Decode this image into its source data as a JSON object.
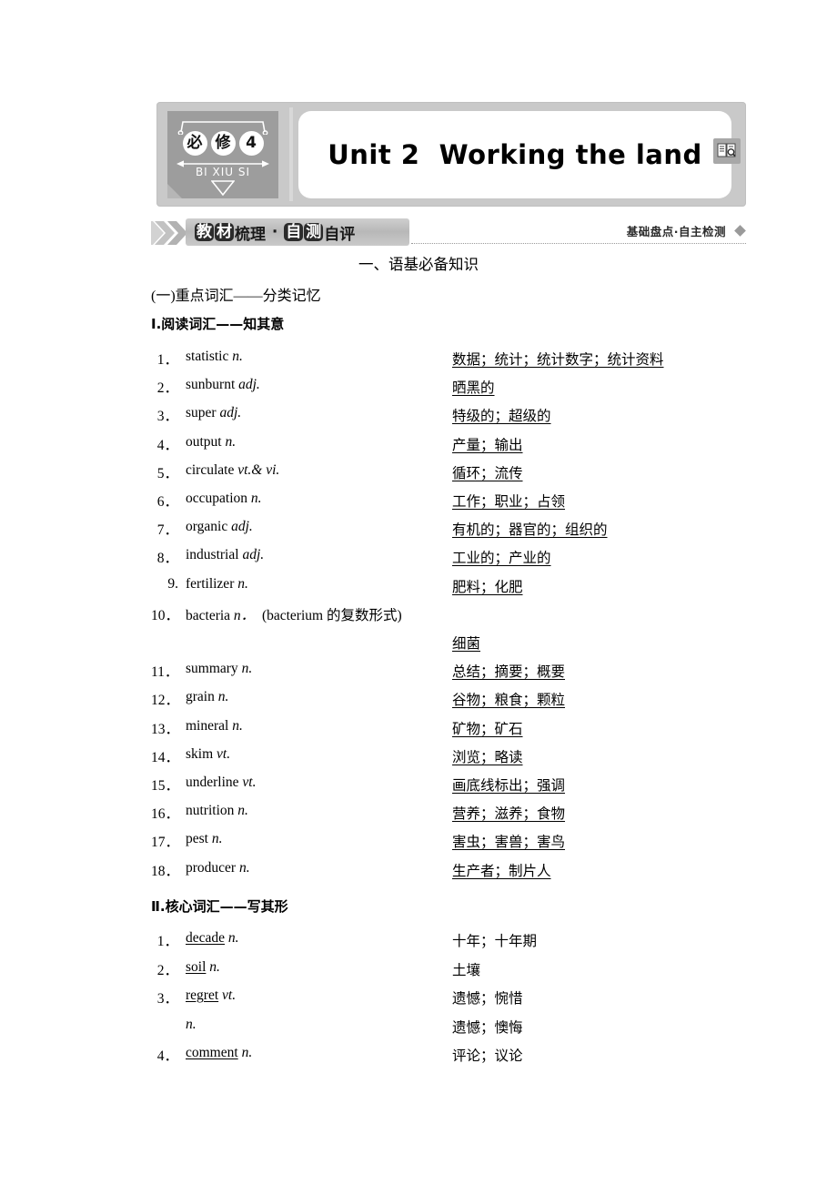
{
  "banner": {
    "badge": {
      "circles": [
        "必",
        "修",
        "4"
      ],
      "pinyin": "BI XIU SI"
    },
    "unit_title": "Unit 2  Working the land",
    "book_icon": "book-search-icon"
  },
  "section_header": {
    "title_parts": [
      {
        "text": "教",
        "boxed": true
      },
      {
        "text": "材",
        "boxed": true
      },
      {
        "text": "梳理",
        "boxed": false
      },
      {
        "text": " · ",
        "boxed": false
      },
      {
        "text": "自",
        "boxed": true
      },
      {
        "text": "测",
        "boxed": true
      },
      {
        "text": "自评",
        "boxed": false
      }
    ],
    "title_plain": "教材梳理·自测自评",
    "right_label": "基础盘点·自主检测"
  },
  "headings": {
    "part_one": "一、语基必备知识",
    "sub_one": "(一)重点词汇——分类记忆",
    "list_one_title": "Ⅰ.阅读词汇——知其意",
    "list_two_title": "Ⅱ.核心词汇——写其形"
  },
  "reading_vocab": [
    {
      "num": "1．",
      "word": "statistic ",
      "pos": "n.",
      "def": "数据；统计；统计数字；统计资料",
      "underlined": true
    },
    {
      "num": "2．",
      "word": "sunburnt ",
      "pos": "adj.",
      "def": "晒黑的",
      "underlined": true
    },
    {
      "num": "3．",
      "word": "super ",
      "pos": "adj.",
      "def": "特级的；超级的",
      "underlined": true
    },
    {
      "num": "4．",
      "word": "output ",
      "pos": "n.",
      "def": "产量；输出",
      "underlined": true
    },
    {
      "num": "5．",
      "word": "circulate ",
      "pos": "vt.& vi.",
      "def": "循环；流传",
      "underlined": true
    },
    {
      "num": "6．",
      "word": "occupation ",
      "pos": "n.",
      "def": "工作；职业；占领",
      "underlined": true
    },
    {
      "num": "7．",
      "word": "organic ",
      "pos": "adj.",
      "def": "有机的；器官的；组织的",
      "underlined": true
    },
    {
      "num": "8．",
      "word": "industrial ",
      "pos": "adj.",
      "def": "工业的；产业的",
      "underlined": true
    },
    {
      "num": "9.",
      "word": "fertilizer ",
      "pos": "n.",
      "def": "肥料；化肥",
      "underlined": true
    },
    {
      "num": "10．",
      "word": "bacteria ",
      "pos": "n．",
      "note": "(bacterium 的复数形式)",
      "def": "",
      "underlined": true
    },
    {
      "num": "",
      "word": "",
      "pos": "",
      "def": "细菌",
      "underlined": true
    },
    {
      "num": "11．",
      "word": "summary ",
      "pos": "n.",
      "def": "总结；摘要；概要",
      "underlined": true
    },
    {
      "num": "12．",
      "word": "grain ",
      "pos": "n.",
      "def": "谷物；粮食；颗粒",
      "underlined": true
    },
    {
      "num": "13．",
      "word": "mineral ",
      "pos": "n.",
      "def": "矿物；矿石",
      "underlined": true
    },
    {
      "num": "14．",
      "word": "skim ",
      "pos": "vt.",
      "def": "浏览；略读",
      "underlined": true
    },
    {
      "num": "15．",
      "word": "underline ",
      "pos": "vt.",
      "def": "画底线标出；强调",
      "underlined": true
    },
    {
      "num": "16．",
      "word": "nutrition ",
      "pos": "n.",
      "def": "营养；滋养；食物",
      "underlined": true
    },
    {
      "num": "17．",
      "word": "pest ",
      "pos": "n.",
      "def": "害虫；害兽；害鸟",
      "underlined": true
    },
    {
      "num": "18．",
      "word": "producer ",
      "pos": "n.",
      "def": "生产者；制片人",
      "underlined": true
    }
  ],
  "core_vocab": [
    {
      "num": "1．",
      "blank": "decade",
      "pos": " n.",
      "def": "十年；十年期"
    },
    {
      "num": "2．",
      "blank": "soil",
      "pos": " n.",
      "def": "土壤"
    },
    {
      "num": "3．",
      "blank": "regret",
      "pos": " vt.",
      "def": "遗憾；惋惜"
    },
    {
      "num": "",
      "blank": "",
      "pos": "n.",
      "def": "遗憾；懊悔"
    },
    {
      "num": "4．",
      "blank": "comment",
      "pos": " n.",
      "def": "评论；议论"
    }
  ]
}
